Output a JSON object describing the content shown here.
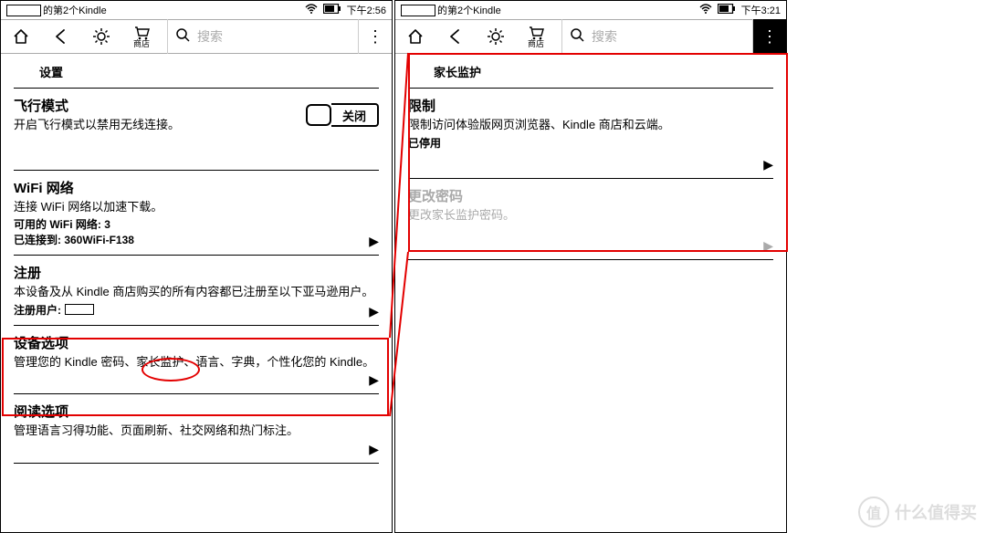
{
  "left": {
    "status": {
      "device": "的第2个Kindle",
      "time": "下午2:56"
    },
    "toolbar": {
      "shop_label": "商店",
      "search_placeholder": "搜索"
    },
    "header": "设置",
    "rows": {
      "airplane": {
        "title": "飞行模式",
        "desc": "开启飞行模式以禁用无线连接。",
        "toggle": "关闭"
      },
      "wifi": {
        "title": "WiFi 网络",
        "desc": "连接 WiFi 网络以加速下载。",
        "sub1": "可用的 WiFi 网络: 3",
        "sub2": "已连接到: 360WiFi-F138"
      },
      "register": {
        "title": "注册",
        "desc": "本设备及从 Kindle 商店购买的所有内容都已注册至以下亚马逊用户。",
        "sub1": "注册用户:"
      },
      "device": {
        "title": "设备选项",
        "desc": "管理您的 Kindle 密码、家长监护、语言、字典，个性化您的 Kindle。"
      },
      "reading": {
        "title": "阅读选项",
        "desc": "管理语言习得功能、页面刷新、社交网络和热门标注。"
      }
    }
  },
  "right": {
    "status": {
      "device": "的第2个Kindle",
      "time": "下午3:21"
    },
    "toolbar": {
      "shop_label": "商店",
      "search_placeholder": "搜索"
    },
    "header": "家长监护",
    "rows": {
      "restrict": {
        "title": "限制",
        "desc": "限制访问体验版网页浏览器、Kindle 商店和云端。",
        "sub1": "已停用"
      },
      "changepw": {
        "title": "更改密码",
        "desc": "更改家长监护密码。"
      }
    }
  },
  "watermark": {
    "icon": "值",
    "text": "什么值得买"
  }
}
